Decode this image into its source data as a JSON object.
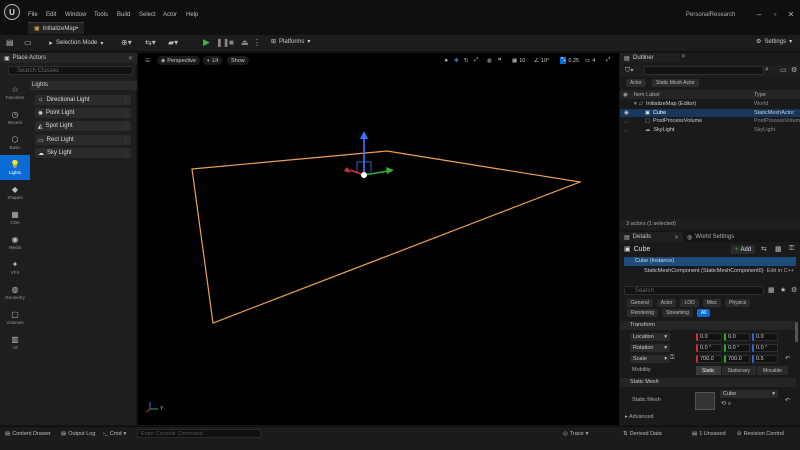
{
  "menu": [
    "File",
    "Edit",
    "Window",
    "Tools",
    "Build",
    "Select",
    "Actor",
    "Help"
  ],
  "project_name": "PersonalResearch",
  "map_tab": "InitializeMap•",
  "toolbar": {
    "selection_mode": "Selection Mode",
    "platforms": "Platforms",
    "settings": "Settings"
  },
  "place_actors": {
    "title": "Place Actors",
    "search_placeholder": "Search Classes",
    "categories": [
      "Favorites",
      "Recent",
      "Basic",
      "Lights",
      "Shapes",
      "Cine",
      "Media",
      "VFX",
      "Geometry",
      "Volumes",
      "All"
    ],
    "active_category": "Lights",
    "section": "Lights",
    "items": [
      "Directional Light",
      "Point Light",
      "Spot Light",
      "Rect Light",
      "Sky Light"
    ]
  },
  "viewport": {
    "perspective": "Perspective",
    "lit": "Lit",
    "show": "Show",
    "grid_snap": "10",
    "rot_snap": "10°",
    "scale_snap": "0.25",
    "cam_speed": "4",
    "axis_label": "Y"
  },
  "outliner": {
    "title": "Outliner",
    "search_placeholder": "",
    "filters": [
      "Actor",
      "Static Mesh Actor"
    ],
    "col_label": "Item Label",
    "col_type": "Type",
    "rows": [
      {
        "label": "InitializeMap (Editor)",
        "type": "World"
      },
      {
        "label": "Cube",
        "type": "StaticMeshActor"
      },
      {
        "label": "PostProcessVolume",
        "type": "PostProcessVolum"
      },
      {
        "label": "SkyLight",
        "type": "SkyLight"
      }
    ],
    "status": "3 actors (1 selected)"
  },
  "details": {
    "tab": "Details",
    "tab2": "World Settings",
    "object": "Cube",
    "add": "Add",
    "instance": "Cube (Instance)",
    "component": "StaticMeshComponent (StaticMeshComponent0)",
    "edit_cpp": "Edit in C++",
    "search_placeholder": "Search",
    "filters_row1": [
      "General",
      "Actor",
      "LOD",
      "Misc",
      "Physics"
    ],
    "filters_row2": [
      "Rendering",
      "Streaming",
      "All"
    ],
    "transform": {
      "section": "Transform",
      "location_label": "Location",
      "location": [
        "0.0",
        "0.0",
        "0.0"
      ],
      "rotation_label": "Rotation",
      "rotation": [
        "0.0 °",
        "0.0 °",
        "0.0 °"
      ],
      "scale_label": "Scale",
      "scale": [
        "700.0",
        "700.0",
        "0.5"
      ],
      "mobility_label": "Mobility",
      "mobility": [
        "Static",
        "Stationary",
        "Movable"
      ]
    },
    "static_mesh": {
      "section": "Static Mesh",
      "label": "Static Mesh",
      "value": "Cube"
    },
    "advanced": "Advanced"
  },
  "bottombar": {
    "content_drawer": "Content Drawer",
    "output_log": "Output Log",
    "cmd": "Cmd",
    "console_placeholder": "Enter Console Command",
    "trace": "Trace",
    "derived_data": "Derived Data",
    "unsaved": "1 Unsaved",
    "revision": "Revision Control"
  },
  "colors": {
    "accent": "#0b6bd6",
    "selection": "#18375c",
    "plane_outline": "#f0a050"
  }
}
